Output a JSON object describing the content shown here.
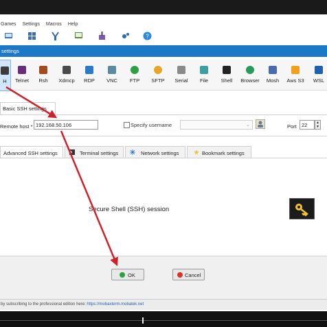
{
  "menu": [
    "Games",
    "Settings",
    "Macros",
    "Help"
  ],
  "dialog": {
    "title": "settings"
  },
  "session_types": [
    "H",
    "Telnet",
    "Rsh",
    "Xdmcp",
    "RDP",
    "VNC",
    "FTP",
    "SFTP",
    "Serial",
    "File",
    "Shell",
    "Browser",
    "Mosh",
    "Aws S3",
    "WSL"
  ],
  "basic_tab": {
    "label": "Basic SSH settings"
  },
  "remote_host": {
    "label": "Remote host *",
    "value": "192.168.50.106"
  },
  "specify_username": {
    "label": "Specify username",
    "value": ""
  },
  "port": {
    "label": "Port",
    "value": "22"
  },
  "tabs": [
    "Advanced SSH settings",
    "Terminal settings",
    "Network settings",
    "Bookmark settings"
  ],
  "session_description": "Secure Shell (SSH) session",
  "buttons": {
    "ok": "OK",
    "cancel": "Cancel"
  },
  "footer": {
    "text": "by subscribing to the professional edition here:",
    "link": "https://mobaxterm.mobatek.net"
  },
  "colors": {
    "titlebar": "#1e78c8",
    "arrow": "#d0202a",
    "ok_icon": "#2ea043",
    "cancel_icon": "#d9342b",
    "key": "#f2c230"
  }
}
